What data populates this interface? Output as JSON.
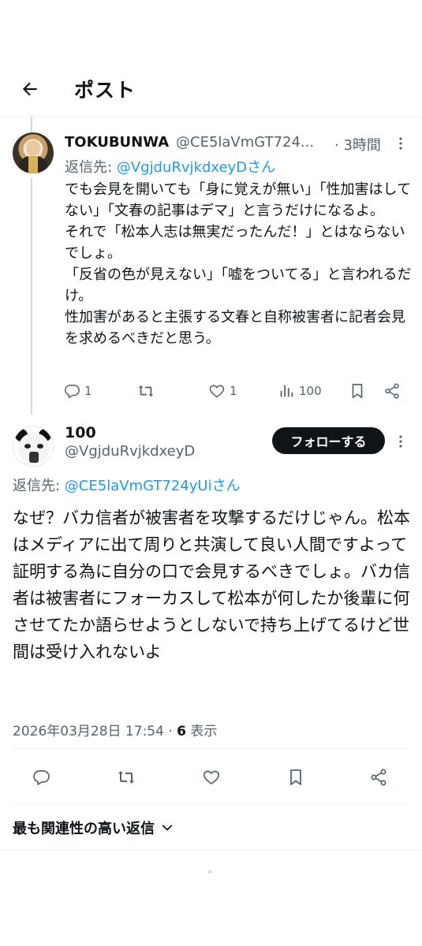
{
  "header": {
    "title": "ポスト"
  },
  "tweet1": {
    "name": "TOKUBUNWA",
    "handle": "@CE5laVmGT724...",
    "time": "· 3時間",
    "reply_label": "返信先: ",
    "reply_handle": "@VgjduRvjkdxeyDさん",
    "text": "でも会見を開いても「身に覚えが無い」「性加害はしてない」「文春の記事はデマ」と言うだけになるよ。\nそれで「松本人志は無実だったんだ！」とはならないでしょ。\n「反省の色が見えない」「嘘をついてる」と言われるだけ。\n性加害があると主張する文春と自称被害者に記者会見を求めるべきだと思う。",
    "replies": "1",
    "reposts": "",
    "likes": "1",
    "views": "100"
  },
  "tweet2": {
    "name": "100",
    "handle": "@VgjduRvjkdxeyD",
    "follow_label": "フォローする",
    "reply_label": "返信先: ",
    "reply_handle": "@CE5laVmGT724yUiさん",
    "text": "なぜ？バカ信者が被害者を攻撃するだけじゃん。松本はメディアに出て周りと共演して良い人間ですよって証明する為に自分の口で会見するべきでしょ。バカ信者は被害者にフォーカスして松本が何したか後輩に何させてたか語らせようとしないで持ち上げてるけど世間は受け入れないよ",
    "timestamp": "2026年03月28日 17:54 · ",
    "views_count": "6",
    "views_label": " 表示"
  },
  "sort": {
    "label": "最も関連性の高い返信"
  },
  "icons": {
    "back": "back-arrow-icon",
    "more": "more-vertical-icon",
    "reply": "reply-icon",
    "repost": "repost-icon",
    "like": "like-icon",
    "views": "views-icon",
    "bookmark": "bookmark-icon",
    "share": "share-icon"
  },
  "colors": {
    "link": "#1d9bf0",
    "muted": "#536471",
    "text": "#0f1419",
    "follow_bg": "#0f1419"
  }
}
